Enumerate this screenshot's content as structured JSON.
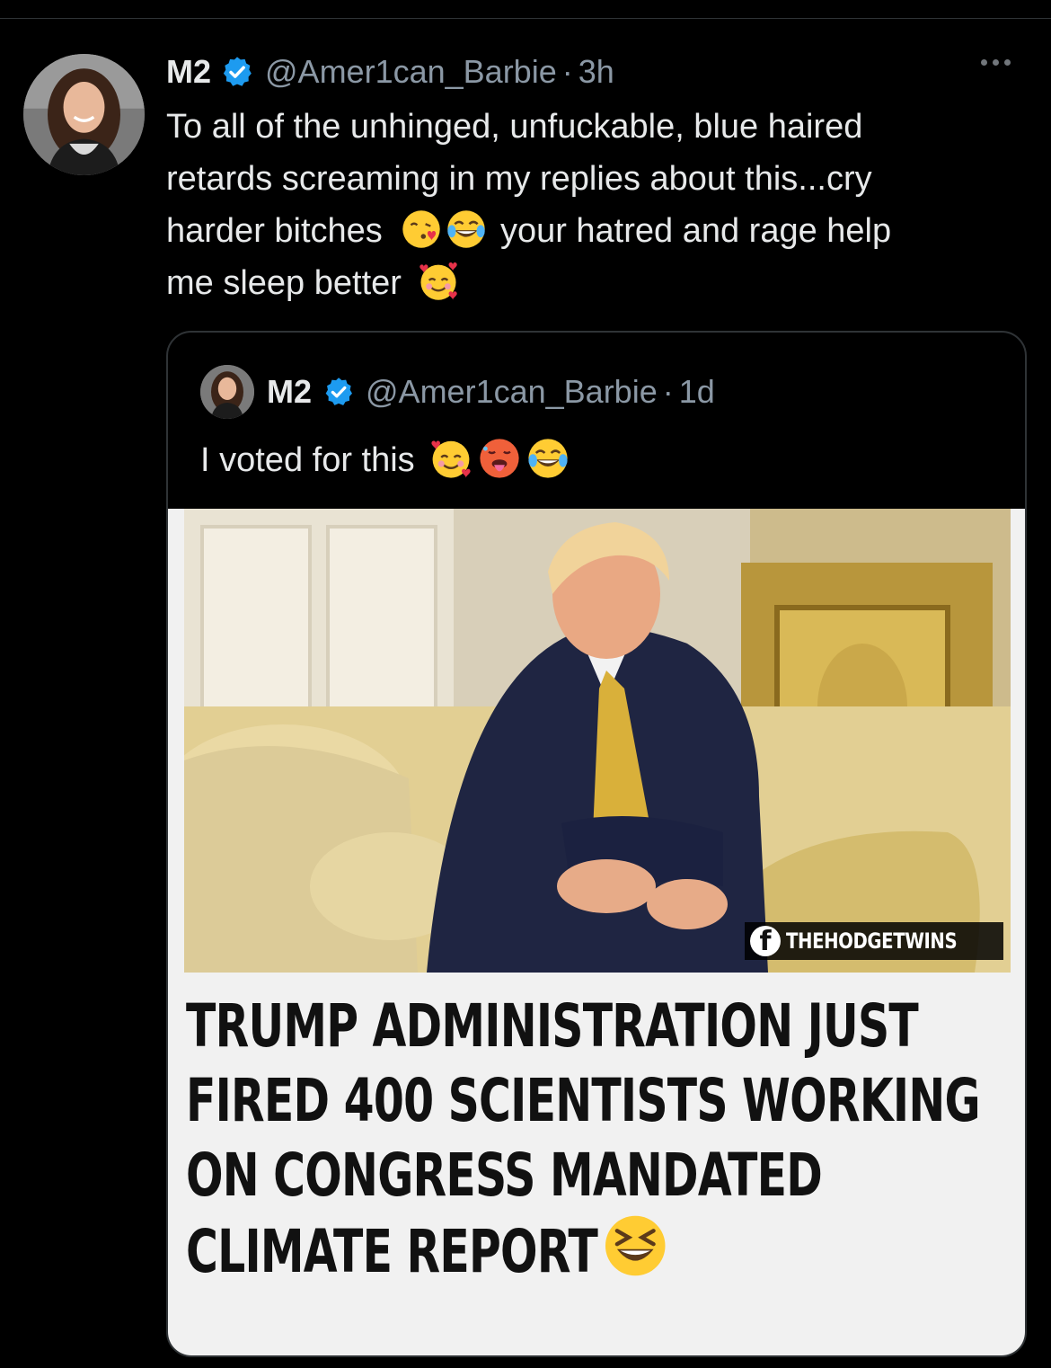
{
  "tweet": {
    "display_name": "M2",
    "handle": "@Amer1can_Barbie",
    "separator": "·",
    "time": "3h",
    "text_lines": [
      "To all of the unhinged, unfuckable, blue haired",
      "retards screaming in my replies about this...cry",
      "harder bitches",
      "your hatred and rage help",
      "me sleep better"
    ],
    "emojis": [
      "face-blowing-kiss",
      "tears-of-joy",
      "smiling-face-with-hearts"
    ]
  },
  "quoted_tweet": {
    "display_name": "M2",
    "handle": "@Amer1can_Barbie",
    "separator": "·",
    "time": "1d",
    "text": "I voted for this",
    "emojis": [
      "smiling-face-with-hearts",
      "hot-face",
      "tears-of-joy"
    ],
    "media": {
      "watermark": "THEHODGETWINS",
      "watermark_icon": "f",
      "headline_lines": [
        "TRUMP ADMINISTRATION JUST",
        "FIRED 400 SCIENTISTS WORKING",
        "ON CONGRESS MANDATED",
        "CLIMATE REPORT"
      ],
      "headline_emoji": "grinning-squinting-face"
    }
  },
  "colors": {
    "background": "#000000",
    "text_primary": "#e7e9ea",
    "text_secondary": "#8b98a5",
    "verified_blue": "#1d9bf0",
    "card_border": "#2f3336",
    "headline_text": "#111111",
    "headline_bg": "#f1f1f1"
  }
}
